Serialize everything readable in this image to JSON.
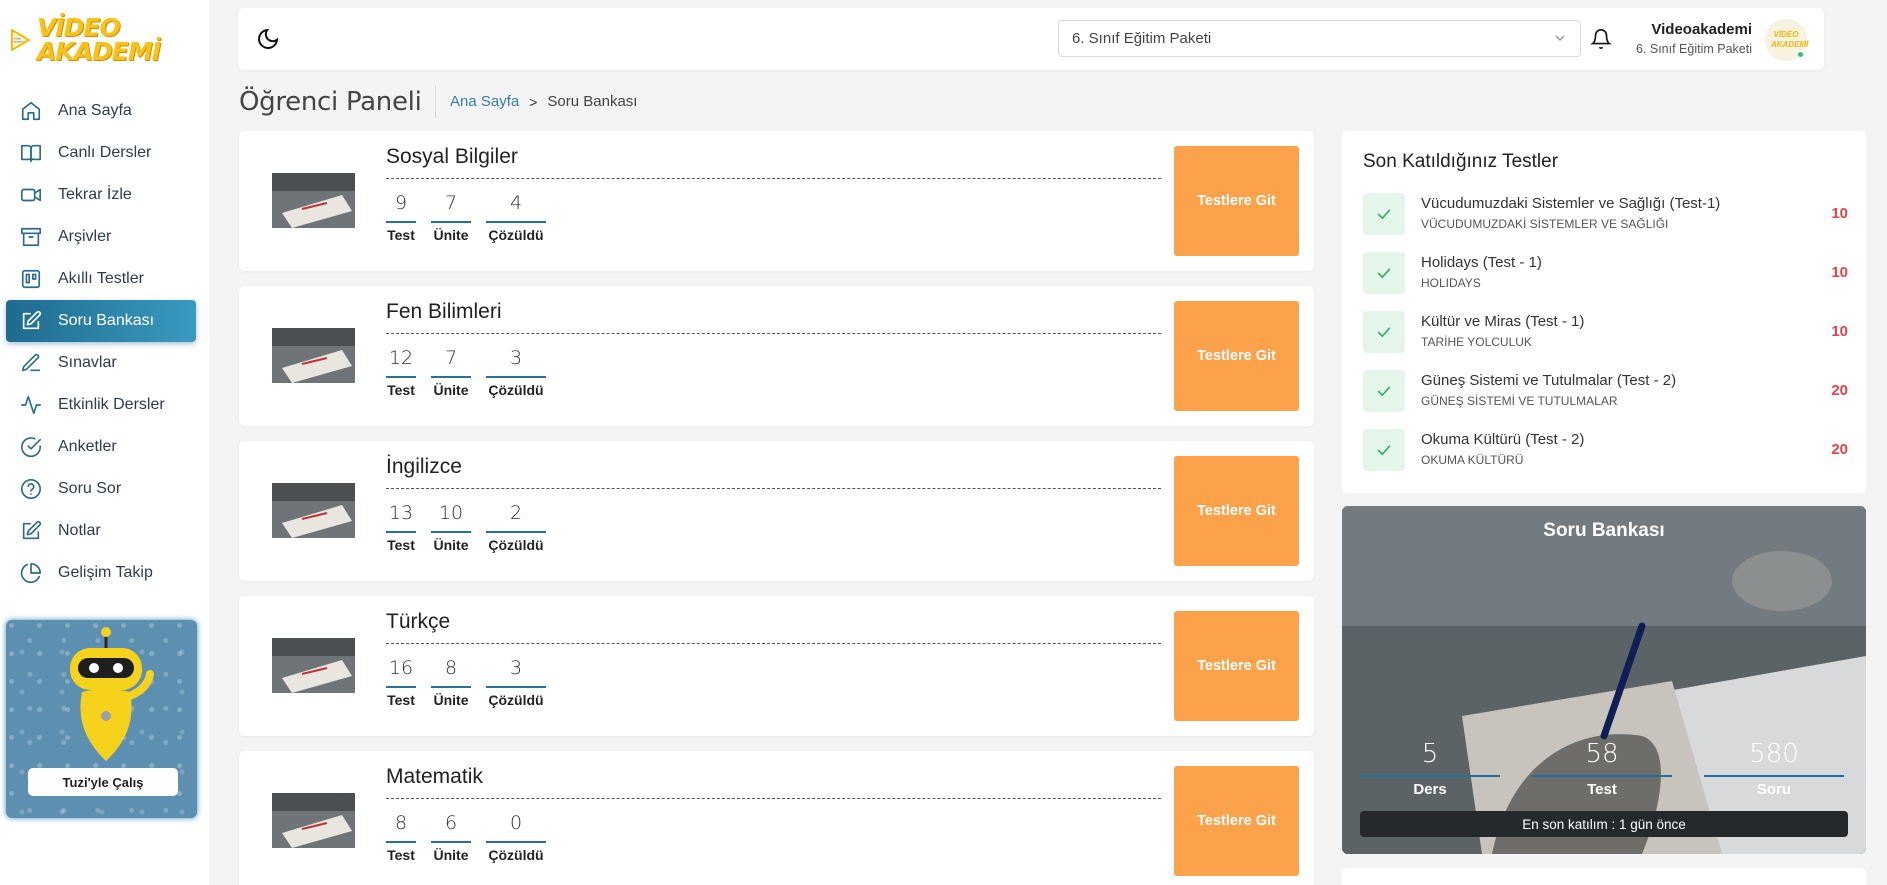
{
  "brand": {
    "logo_text": "VİDEO AKADEMİ"
  },
  "sidebar": {
    "items": [
      {
        "label": "Ana Sayfa",
        "icon": "home-icon"
      },
      {
        "label": "Canlı Dersler",
        "icon": "book-open-icon"
      },
      {
        "label": "Tekrar İzle",
        "icon": "video-icon"
      },
      {
        "label": "Arşivler",
        "icon": "archive-icon"
      },
      {
        "label": "Akıllı Testler",
        "icon": "trello-icon"
      },
      {
        "label": "Soru Bankası",
        "icon": "edit-icon",
        "active": true
      },
      {
        "label": "Sınavlar",
        "icon": "pen-icon"
      },
      {
        "label": "Etkinlik Dersler",
        "icon": "activity-icon"
      },
      {
        "label": "Anketler",
        "icon": "check-circle-icon"
      },
      {
        "label": "Soru Sor",
        "icon": "help-circle-icon"
      },
      {
        "label": "Notlar",
        "icon": "edit-note-icon"
      },
      {
        "label": "Gelişim Takip",
        "icon": "pie-chart-icon"
      }
    ],
    "tuzi_button": "Tuzi'yle Çalış"
  },
  "header": {
    "package_select": "6. Sınıf Eğitim Paketi",
    "user_name": "Videoakademi",
    "user_package": "6. Sınıf Eğitim Paketi",
    "avatar_text": "VİDEO AKADEMİ"
  },
  "page": {
    "title": "Öğrenci Paneli",
    "breadcrumb_home": "Ana Sayfa",
    "breadcrumb_sep": ">",
    "breadcrumb_current": "Soru Bankası"
  },
  "stat_labels": {
    "test": "Test",
    "unite": "Ünite",
    "solved": "Çözüldü"
  },
  "subjects": [
    {
      "name": "Sosyal Bilgiler",
      "test": "9",
      "unite": "7",
      "solved": "4",
      "button": "Testlere Git"
    },
    {
      "name": "Fen Bilimleri",
      "test": "12",
      "unite": "7",
      "solved": "3",
      "button": "Testlere Git"
    },
    {
      "name": "İngilizce",
      "test": "13",
      "unite": "10",
      "solved": "2",
      "button": "Testlere Git"
    },
    {
      "name": "Türkçe",
      "test": "16",
      "unite": "8",
      "solved": "3",
      "button": "Testlere Git"
    },
    {
      "name": "Matematik",
      "test": "8",
      "unite": "6",
      "solved": "0",
      "button": "Testlere Git"
    }
  ],
  "recent": {
    "title": "Son Katıldığınız Testler",
    "items": [
      {
        "name": "Vücudumuzdaki Sistemler ve Sağlığı (Test-1)",
        "sub": "VÜCUDUMUZDAKİ SİSTEMLER VE SAĞLIĞI",
        "score": "10"
      },
      {
        "name": "Holidays (Test - 1)",
        "sub": "HOLIDAYS",
        "score": "10"
      },
      {
        "name": "Kültür ve Miras (Test - 1)",
        "sub": "TARİHE YOLCULUK",
        "score": "10"
      },
      {
        "name": "Güneş Sistemi ve Tutulmalar (Test - 2)",
        "sub": "GÜNEŞ SİSTEMİ VE TUTULMALAR",
        "score": "20"
      },
      {
        "name": "Okuma Kültürü (Test - 2)",
        "sub": "OKUMA KÜLTÜRÜ",
        "score": "20"
      }
    ]
  },
  "qbank": {
    "title": "Soru Bankası",
    "stats": [
      {
        "num": "5",
        "label": "Ders"
      },
      {
        "num": "58",
        "label": "Test"
      },
      {
        "num": "580",
        "label": "Soru"
      }
    ],
    "last": "En son katılım : 1 gün önce"
  },
  "colors": {
    "accent": "#2b6b8f",
    "orange_button": "#fca24a",
    "score_red": "#e0434a",
    "check_green": "#2fb167"
  }
}
